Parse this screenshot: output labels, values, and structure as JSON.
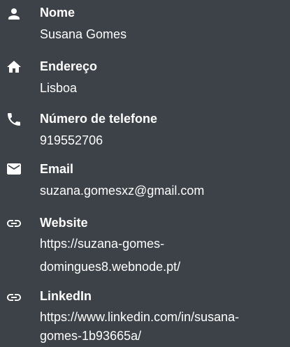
{
  "contacts": [
    {
      "icon": "person-icon",
      "label": "Nome",
      "value": "Susana Gomes"
    },
    {
      "icon": "home-icon",
      "label": "Endereço",
      "value": "Lisboa"
    },
    {
      "icon": "phone-icon",
      "label": "Número de telefone",
      "value": "919552706"
    },
    {
      "icon": "email-icon",
      "label": "Email",
      "value": "suzana.gomesxz@gmail.com"
    },
    {
      "icon": "link-icon",
      "label": "Website",
      "value_line1": "https://suzana-gomes-",
      "value_line2": "domingues8.webnode.pt/"
    },
    {
      "icon": "link-icon",
      "label": "LinkedIn",
      "value_line1": "https://www.linkedin.com/in/susana-",
      "value_line2": "gomes-1b93665a/"
    }
  ],
  "colors": {
    "background": "#3d4148",
    "text": "#ffffff"
  }
}
